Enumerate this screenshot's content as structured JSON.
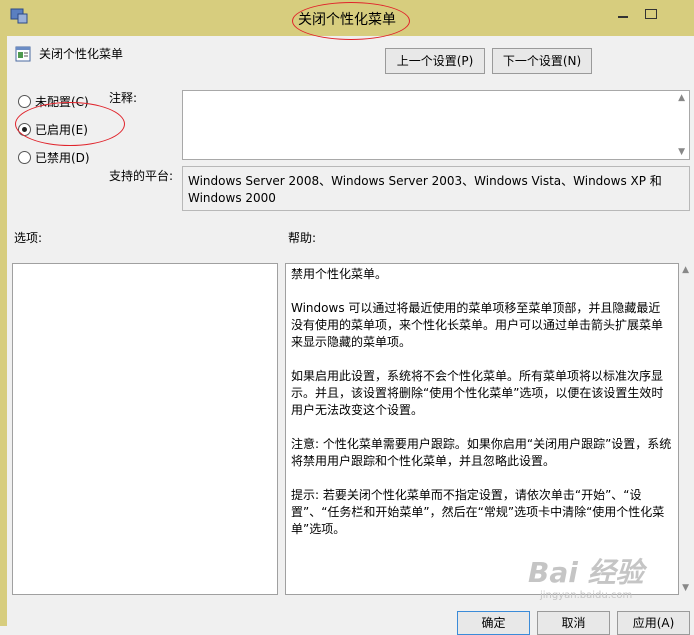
{
  "window": {
    "title": "关闭个性化菜单"
  },
  "header": {
    "policy_name": "关闭个性化菜单",
    "prev_label": "上一个设置(P)",
    "next_label": "下一个设置(N)"
  },
  "state": {
    "options": [
      {
        "label": "未配置(C)",
        "selected": false
      },
      {
        "label": "已启用(E)",
        "selected": true
      },
      {
        "label": "已禁用(D)",
        "selected": false
      }
    ]
  },
  "comment": {
    "label": "注释:",
    "value": ""
  },
  "platform": {
    "label": "支持的平台:",
    "value": "Windows Server 2008、Windows Server 2003、Windows Vista、Windows XP 和 Windows 2000"
  },
  "options_section": {
    "label": "选项:"
  },
  "help_section": {
    "label": "帮助:",
    "paragraphs": [
      "禁用个性化菜单。",
      "Windows 可以通过将最近使用的菜单项移至菜单顶部，并且隐藏最近没有使用的菜单项，来个性化长菜单。用户可以通过单击箭头扩展菜单来显示隐藏的菜单项。",
      "如果启用此设置，系统将不会个性化菜单。所有菜单项将以标准次序显示。并且，该设置将删除“使用个性化菜单”选项，以便在该设置生效时用户无法改变这个设置。",
      "注意: 个性化菜单需要用户跟踪。如果你启用“关闭用户跟踪”设置，系统将禁用用户跟踪和个性化菜单，并且忽略此设置。",
      "提示: 若要关闭个性化菜单而不指定设置，请依次单击“开始”、“设置”、“任务栏和开始菜单”，然后在“常规”选项卡中清除“使用个性化菜单”选项。"
    ]
  },
  "footer": {
    "ok_label": "确定",
    "cancel_label": "取消",
    "apply_label": "应用(A)"
  },
  "watermark": {
    "text": "Bai 经验",
    "sub": "jingyan.baidu.com"
  },
  "colors": {
    "titlebar": "#d7cd7e",
    "annotation": "#e0232b"
  }
}
